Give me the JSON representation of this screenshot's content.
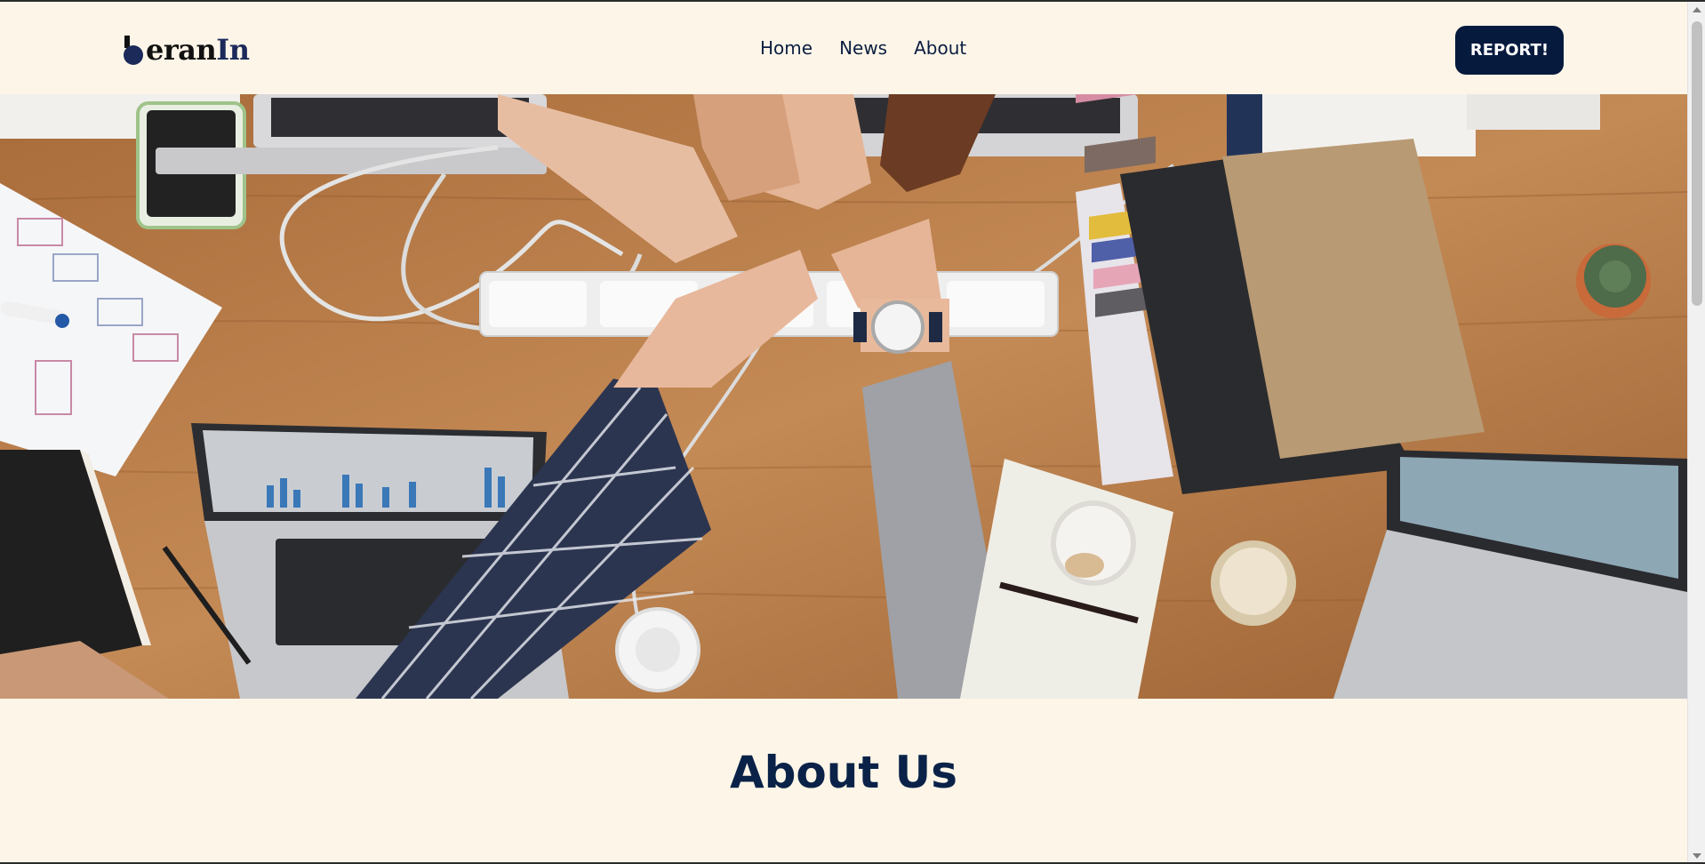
{
  "brand": {
    "logo_part1": "eran",
    "logo_part2": "In"
  },
  "nav": {
    "items": [
      {
        "label": "Home"
      },
      {
        "label": "News"
      },
      {
        "label": "About"
      }
    ],
    "cta_label": "REPORT!"
  },
  "hero": {
    "image_alt": "Team fist bump over a wooden desk with laptops, notebooks and coffee cups"
  },
  "main": {
    "section_title": "About Us"
  },
  "colors": {
    "background": "#fdf6e8",
    "navy": "#061a3e",
    "text": "#0c1e42"
  },
  "icons": {
    "logo": "brand-logo-mark",
    "scroll_up": "chevron-up-icon",
    "scroll_down": "chevron-down-icon"
  }
}
